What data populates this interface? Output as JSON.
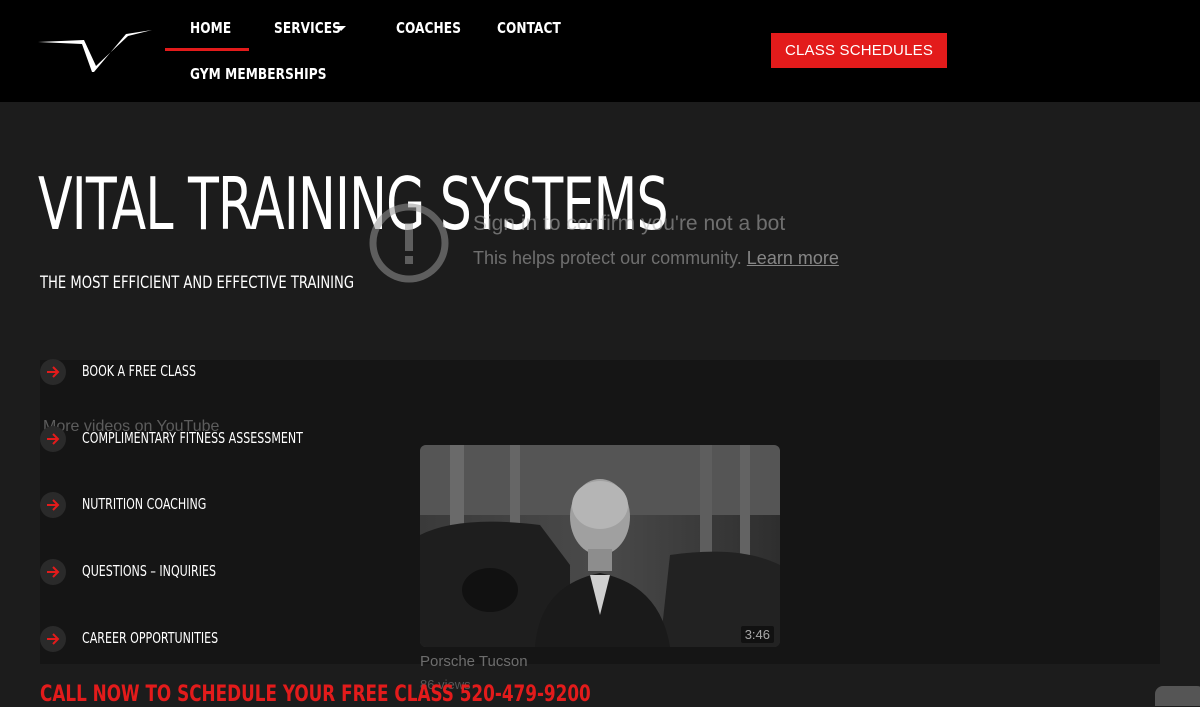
{
  "header": {
    "nav": {
      "home": "HOME",
      "services": "SERVICES",
      "coaches": "COACHES",
      "contact": "CONTACT",
      "memberships": "GYM MEMBERSHIPS"
    },
    "cta_label": "CLASS SCHEDULES"
  },
  "hero": {
    "title": "VITAL TRAINING SYSTEMS",
    "subtitle": "THE MOST EFFICIENT AND EFFECTIVE TRAINING"
  },
  "youtube": {
    "message_title": "Sign in to confirm you're not a bot",
    "message_sub": "This helps protect our community.",
    "learn_more": "Learn more",
    "more_videos": "More videos on YouTube",
    "video_title": "Porsche Tucson",
    "video_views": "86 views",
    "video_duration": "3:46"
  },
  "services": [
    {
      "label": "BOOK A FREE CLASS",
      "icon": "arrow-right-icon"
    },
    {
      "label": "COMPLIMENTARY FITNESS ASSESSMENT",
      "icon": "arrow-right-icon"
    },
    {
      "label": "NUTRITION COACHING",
      "icon": "arrow-right-icon"
    },
    {
      "label": "QUESTIONS – INQUIRIES",
      "icon": "arrow-right-icon"
    },
    {
      "label": "CAREER OPPORTUNITIES",
      "icon": "arrow-right-icon"
    }
  ],
  "callout": "CALL NOW TO SCHEDULE YOUR FREE CLASS 520-479-9200",
  "colors": {
    "accent": "#e31b1b",
    "header_bg": "#000000",
    "page_bg": "#1c1c1c"
  }
}
